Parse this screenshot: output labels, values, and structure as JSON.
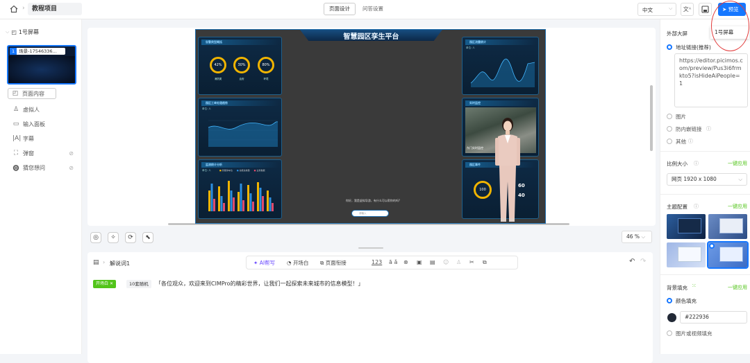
{
  "topbar": {
    "project": "教程项目",
    "tab_design": "页面设计",
    "tab_qa": "问答设置",
    "language": "中文",
    "preview": "预览"
  },
  "left": {
    "screen_group": "1号屏幕",
    "scene_index": "1",
    "scene_name": "场景-17546336...",
    "items": [
      {
        "label": "页面内容",
        "icon": "page-icon"
      },
      {
        "label": "虚拟人",
        "icon": "person-icon"
      },
      {
        "label": "输入面板",
        "icon": "input-icon"
      },
      {
        "label": "字幕",
        "icon": "subtitle-icon"
      },
      {
        "label": "弹窗",
        "icon": "popup-icon"
      },
      {
        "label": "猜您想问",
        "icon": "question-icon"
      }
    ]
  },
  "canvas": {
    "title": "智慧园区孪生平台",
    "panel1_title": "告警类型概括",
    "rings": [
      {
        "pct": "42%",
        "label": "消防类"
      },
      {
        "pct": "30%",
        "label": "治安"
      },
      {
        "pct": "80%",
        "label": "环境"
      }
    ],
    "panel2_title": "园区工单处理趋势",
    "panel2_unit": "单位: 人",
    "panel3_title": "监测统计分析",
    "panel3_unit": "单位: 人",
    "panel3_legend": [
      "智能停车位",
      "总能总统量",
      "业务数据"
    ],
    "panel4_title": "园区流量统计",
    "panel4_unit": "单位: 人",
    "panel5_title": "实时监控",
    "panel5_caption": "东门实时监控",
    "panel6_title": "园区事件",
    "panel6_ring": "100",
    "panel6_v1": "60",
    "panel6_v2": "40",
    "axis_ticks": [
      "03/20",
      "03/21",
      "03/22",
      "03/23",
      "03/24",
      "03/25"
    ],
    "greeting": "你好，我是虚拟导游，有什么可以帮你的吗?",
    "input_hint": "请输入"
  },
  "toolbar": {
    "zoom": "46 %",
    "script_title": "解说词1",
    "ai_write": "AI帮写",
    "opening": "开场白",
    "page_link": "页面衔接"
  },
  "script": {
    "tag1": "开场白",
    "tag2": "10套随机",
    "text": "「各位观众，欢迎来到CIMPro的精彩世界，让我们一起探索未来城市的信息模型！」"
  },
  "right": {
    "section_external": "外部大屏",
    "dropdown_option": "1号屏幕",
    "url_option": "地址链接(推荐)",
    "url_value": "https://editor.picimos.com/preview/Pus3i6frmkto5?isHideAiPeople=1",
    "opt_image": "图片",
    "opt_anti": "防内嵌链接",
    "opt_other": "其他",
    "scale_label": "比例大小",
    "apply_all": "一键应用",
    "scale_value": "网页 1920 x 1080",
    "theme_label": "主题配置",
    "bg_label": "背景填充",
    "bg_color_opt": "颜色填充",
    "bg_color": "#222936",
    "bg_media_opt": "图片或视频填充"
  },
  "colors": {
    "accent": "#1677ff",
    "green": "#52c41a",
    "canvas_bg": "#3d3d3d",
    "panel": "#0e2a45",
    "highlight": "#e23b3b"
  }
}
